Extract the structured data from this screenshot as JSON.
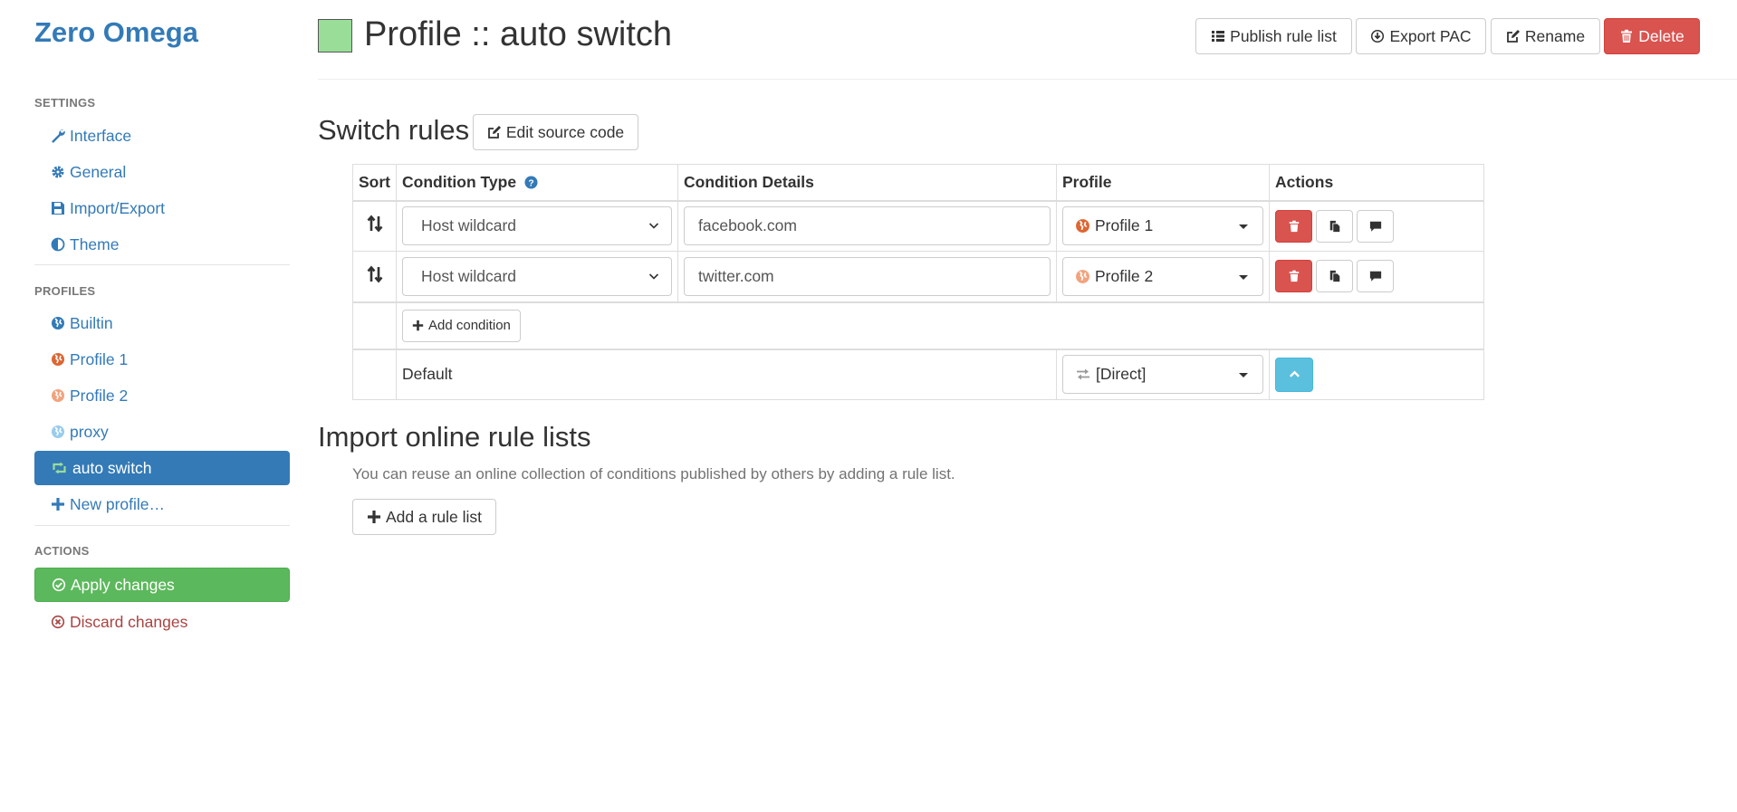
{
  "app": {
    "brand": "Zero Omega"
  },
  "sidebar": {
    "settings_header": "SETTINGS",
    "settings_items": [
      {
        "label": "Interface",
        "icon": "wrench-icon"
      },
      {
        "label": "General",
        "icon": "gear-icon"
      },
      {
        "label": "Import/Export",
        "icon": "floppy-disk-icon"
      },
      {
        "label": "Theme",
        "icon": "contrast-icon"
      }
    ],
    "profiles_header": "PROFILES",
    "profile_items": [
      {
        "label": "Builtin",
        "icon": "globe-icon",
        "color": "#337ab7"
      },
      {
        "label": "Profile 1",
        "icon": "globe-icon",
        "color": "#dd6633"
      },
      {
        "label": "Profile 2",
        "icon": "globe-icon",
        "color": "#f2a37d"
      },
      {
        "label": "proxy",
        "icon": "globe-icon",
        "color": "#99ccee"
      },
      {
        "label": "auto switch",
        "icon": "retweet-icon",
        "color": "#99dd99",
        "active": true
      },
      {
        "label": "New profile…",
        "icon": "plus-icon"
      }
    ],
    "actions_header": "ACTIONS",
    "apply_label": "Apply changes",
    "discard_label": "Discard changes"
  },
  "header": {
    "title": "Profile :: auto switch",
    "profile_color": "#99dd99",
    "buttons": {
      "publish": "Publish rule list",
      "export": "Export PAC",
      "rename": "Rename",
      "delete": "Delete"
    }
  },
  "switch_rules": {
    "title": "Switch rules",
    "edit_source_label": "Edit source code",
    "columns": {
      "sort": "Sort",
      "condition_type": "Condition Type",
      "condition_details": "Condition Details",
      "profile": "Profile",
      "actions": "Actions"
    },
    "rules": [
      {
        "condition_type": "Host wildcard",
        "condition_details": "facebook.com",
        "profile": "Profile 1",
        "profile_color": "#dd6633"
      },
      {
        "condition_type": "Host wildcard",
        "condition_details": "twitter.com",
        "profile": "Profile 2",
        "profile_color": "#f2a37d"
      }
    ],
    "add_condition_label": "Add condition",
    "default_label": "Default",
    "default_profile": "[Direct]"
  },
  "import_rules": {
    "title": "Import online rule lists",
    "help": "You can reuse an online collection of conditions published by others by adding a rule list.",
    "add_label": "Add a rule list"
  },
  "colors": {
    "primary": "#337ab7",
    "danger": "#d9534f",
    "success": "#5cb85c",
    "info": "#5bc0de"
  }
}
